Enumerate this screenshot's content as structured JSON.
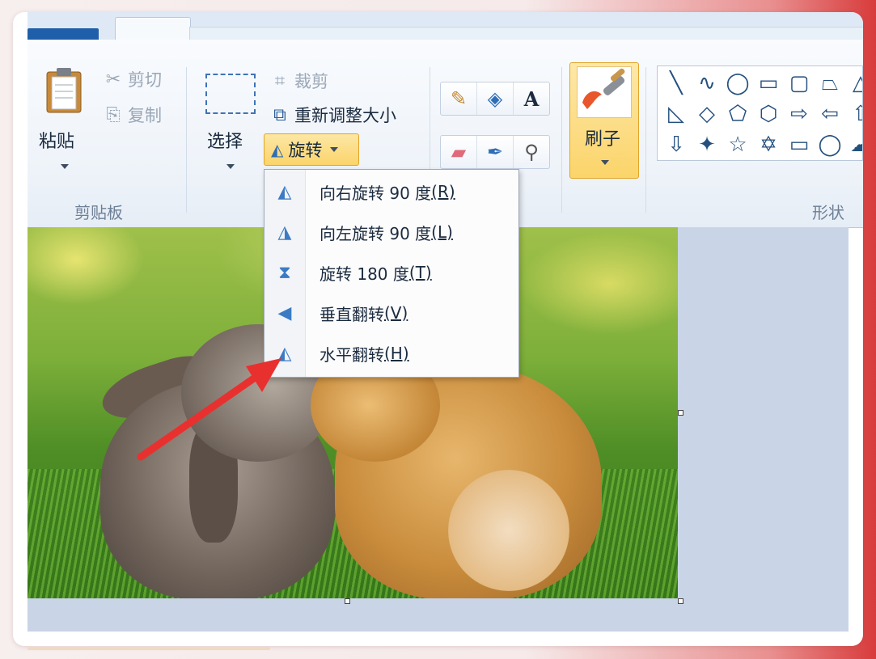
{
  "ribbon": {
    "clipboard": {
      "paste_label": "粘贴",
      "cut_label": "剪切",
      "copy_label": "复制",
      "group_label": "剪贴板"
    },
    "image": {
      "select_label": "选择",
      "crop_label": "裁剪",
      "resize_label": "重新调整大小",
      "rotate_label": "旋转"
    },
    "tools": {
      "pencil_icon": "pencil-icon",
      "fill_icon": "fill-bucket-icon",
      "text_glyph": "A",
      "eraser_icon": "eraser-icon",
      "picker_icon": "color-picker-icon",
      "magnifier_icon": "magnifier-icon"
    },
    "brush_label": "刷子",
    "shapes_group_label": "形状",
    "shapes": [
      "╲",
      "∿",
      "◯",
      "▭",
      "▢",
      "⏢",
      "△",
      "◺",
      "◇",
      "⬠",
      "⬡",
      "⇨",
      "⇦",
      "⇧",
      "⇩",
      "✦",
      "☆",
      "✡",
      "▭",
      "◯",
      "☁"
    ]
  },
  "rotate_menu": {
    "items": [
      {
        "label": "向右旋转 90 度",
        "key": "(R)",
        "icon": "rotate-right-icon"
      },
      {
        "label": "向左旋转 90 度",
        "key": "(L)",
        "icon": "rotate-left-icon"
      },
      {
        "label": "旋转 180 度",
        "key": "(T)",
        "icon": "rotate-180-icon"
      },
      {
        "label": "垂直翻转",
        "key": "(V)",
        "icon": "flip-vertical-icon"
      },
      {
        "label": "水平翻转",
        "key": "(H)",
        "icon": "flip-horizontal-icon"
      }
    ]
  },
  "colors": {
    "accent_orange": "#fbd46a",
    "file_tab_blue": "#1f5ea8",
    "arrow_red": "#e8312f"
  }
}
